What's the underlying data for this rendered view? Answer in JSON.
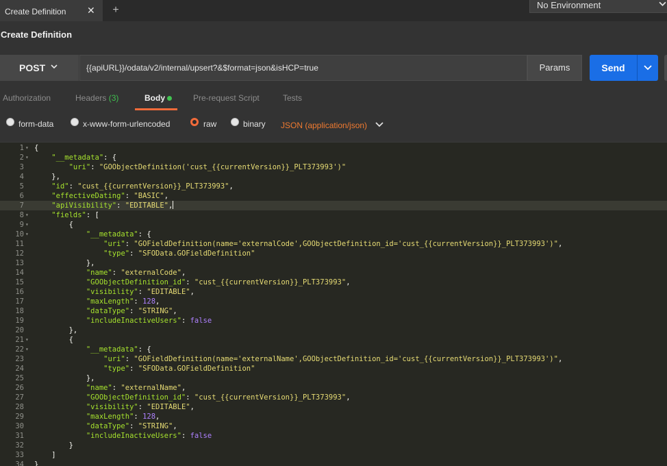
{
  "tabbar": {
    "active_tab_title": "Create Definition",
    "close_glyph": "✕",
    "add_glyph": "+"
  },
  "environment": {
    "label": "No Environment"
  },
  "page_title": "Create Definition",
  "request": {
    "method": "POST",
    "url": "{{apiURL}}/odata/v2/internal/upsert?&$format=json&isHCP=true",
    "params_label": "Params",
    "send_label": "Send"
  },
  "request_tabs": [
    {
      "label": "Authorization",
      "count": ""
    },
    {
      "label": "Headers",
      "count": "(3)"
    },
    {
      "label": "Body",
      "count": ""
    },
    {
      "label": "Pre-request Script",
      "count": ""
    },
    {
      "label": "Tests",
      "count": ""
    }
  ],
  "body_modes": {
    "options": [
      "form-data",
      "x-www-form-urlencoded",
      "raw",
      "binary"
    ],
    "selected": "raw",
    "content_type": "JSON (application/json)"
  },
  "colors": {
    "accent_orange": "#f26b3a",
    "send_blue": "#1a6ee6",
    "status_green": "#41c351",
    "editor_bg": "#272822"
  },
  "icons": [
    "close-icon",
    "plus-icon",
    "chevron-down-icon",
    "radio-icon",
    "fold-arrow-icon",
    "status-dot-icon"
  ],
  "editor": {
    "cursor_line": 7,
    "lines": [
      "{",
      "    \"__metadata\": {",
      "        \"uri\": \"GOObjectDefinition('cust_{{currentVersion}}_PLT373993')\"",
      "    },",
      "    \"id\": \"cust_{{currentVersion}}_PLT373993\",",
      "    \"effectiveDating\": \"BASIC\",",
      "    \"apiVisibility\": \"EDITABLE\",",
      "    \"fields\": [",
      "        {",
      "            \"__metadata\": {",
      "                \"uri\": \"GOFieldDefinition(name='externalCode',GOObjectDefinition_id='cust_{{currentVersion}}_PLT373993')\",",
      "                \"type\": \"SFOData.GOFieldDefinition\"",
      "            },",
      "            \"name\": \"externalCode\",",
      "            \"GOObjectDefinition_id\": \"cust_{{currentVersion}}_PLT373993\",",
      "            \"visibility\": \"EDITABLE\",",
      "            \"maxLength\": 128,",
      "            \"dataType\": \"STRING\",",
      "            \"includeInactiveUsers\": false",
      "        },",
      "        {",
      "            \"__metadata\": {",
      "                \"uri\": \"GOFieldDefinition(name='externalName',GOObjectDefinition_id='cust_{{currentVersion}}_PLT373993')\",",
      "                \"type\": \"SFOData.GOFieldDefinition\"",
      "            },",
      "            \"name\": \"externalName\",",
      "            \"GOObjectDefinition_id\": \"cust_{{currentVersion}}_PLT373993\",",
      "            \"visibility\": \"EDITABLE\",",
      "            \"maxLength\": 128,",
      "            \"dataType\": \"STRING\",",
      "            \"includeInactiveUsers\": false",
      "        }",
      "    ]",
      "}"
    ]
  }
}
